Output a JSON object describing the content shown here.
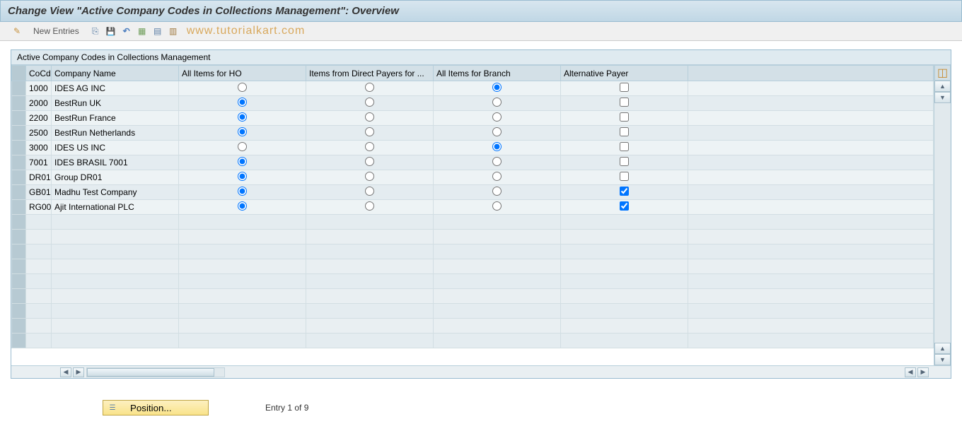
{
  "title": "Change View \"Active Company Codes in Collections Management\": Overview",
  "toolbar": {
    "new_entries": "New Entries",
    "watermark": "www.tutorialkart.com"
  },
  "panel": {
    "title": "Active Company Codes in Collections Management"
  },
  "columns": {
    "cocd": "CoCd",
    "name": "Company Name",
    "ho": "All Items for HO",
    "direct": "Items from Direct Payers for ...",
    "branch": "All Items for Branch",
    "altpay": "Alternative Payer"
  },
  "rows": [
    {
      "cocd": "1000",
      "name": "IDES AG INC",
      "choice": "branch",
      "alt": false
    },
    {
      "cocd": "2000",
      "name": "BestRun UK",
      "choice": "ho",
      "alt": false
    },
    {
      "cocd": "2200",
      "name": "BestRun France",
      "choice": "ho",
      "alt": false
    },
    {
      "cocd": "2500",
      "name": "BestRun Netherlands",
      "choice": "ho",
      "alt": false
    },
    {
      "cocd": "3000",
      "name": "IDES US INC",
      "choice": "branch",
      "alt": false
    },
    {
      "cocd": "7001",
      "name": "IDES BRASIL 7001",
      "choice": "ho",
      "alt": false
    },
    {
      "cocd": "DR01",
      "name": "Group DR01",
      "choice": "ho",
      "alt": false
    },
    {
      "cocd": "GB01",
      "name": "Madhu Test Company",
      "choice": "ho",
      "alt": true
    },
    {
      "cocd": "RG00",
      "name": "Ajit International PLC",
      "choice": "ho",
      "alt": true
    }
  ],
  "footer": {
    "position_label": "Position...",
    "entry_text": "Entry 1 of 9"
  }
}
